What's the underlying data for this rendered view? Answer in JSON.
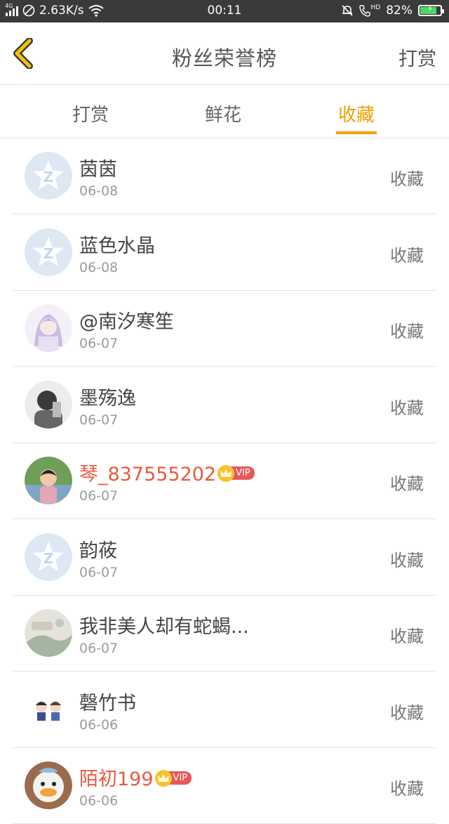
{
  "status_bar": {
    "network": "4G",
    "speed": "2.63K/s",
    "time": "00:11",
    "hd": "HD",
    "battery_percent": "82%",
    "battery_level": 0.82,
    "battery_color": "#4cd964"
  },
  "header": {
    "title": "粉丝荣誉榜",
    "action": "打赏",
    "back_icon": "chevron-left-icon",
    "accent_color": "#f5c400"
  },
  "tabs": [
    {
      "label": "打赏",
      "active": false
    },
    {
      "label": "鲜花",
      "active": false
    },
    {
      "label": "收藏",
      "active": true
    }
  ],
  "active_color": "#f0a000",
  "list": [
    {
      "name": "茵茵",
      "date": "06-08",
      "action": "收藏",
      "avatar": "default-avatar",
      "vip": false
    },
    {
      "name": "蓝色水晶",
      "date": "06-08",
      "action": "收藏",
      "avatar": "default-avatar",
      "vip": false
    },
    {
      "name": "@南汐寒笙",
      "date": "06-07",
      "action": "收藏",
      "avatar": "anime-avatar",
      "vip": false
    },
    {
      "name": "墨殇逸",
      "date": "06-07",
      "action": "收藏",
      "avatar": "photo-avatar",
      "vip": false
    },
    {
      "name": "琴_837555202",
      "date": "06-07",
      "action": "收藏",
      "avatar": "child-photo-avatar",
      "vip": true,
      "vip_label": "VIP"
    },
    {
      "name": "韵莜",
      "date": "06-07",
      "action": "收藏",
      "avatar": "default-avatar",
      "vip": false
    },
    {
      "name": "我非美人却有蛇蝎...",
      "date": "06-07",
      "action": "收藏",
      "avatar": "scenery-avatar",
      "vip": false
    },
    {
      "name": "磬竹书",
      "date": "06-06",
      "action": "收藏",
      "avatar": "cartoon-couple-avatar",
      "vip": false
    },
    {
      "name": "陌初199",
      "date": "06-06",
      "action": "收藏",
      "avatar": "duck-toy-avatar",
      "vip": true,
      "vip_label": "VIP"
    }
  ]
}
